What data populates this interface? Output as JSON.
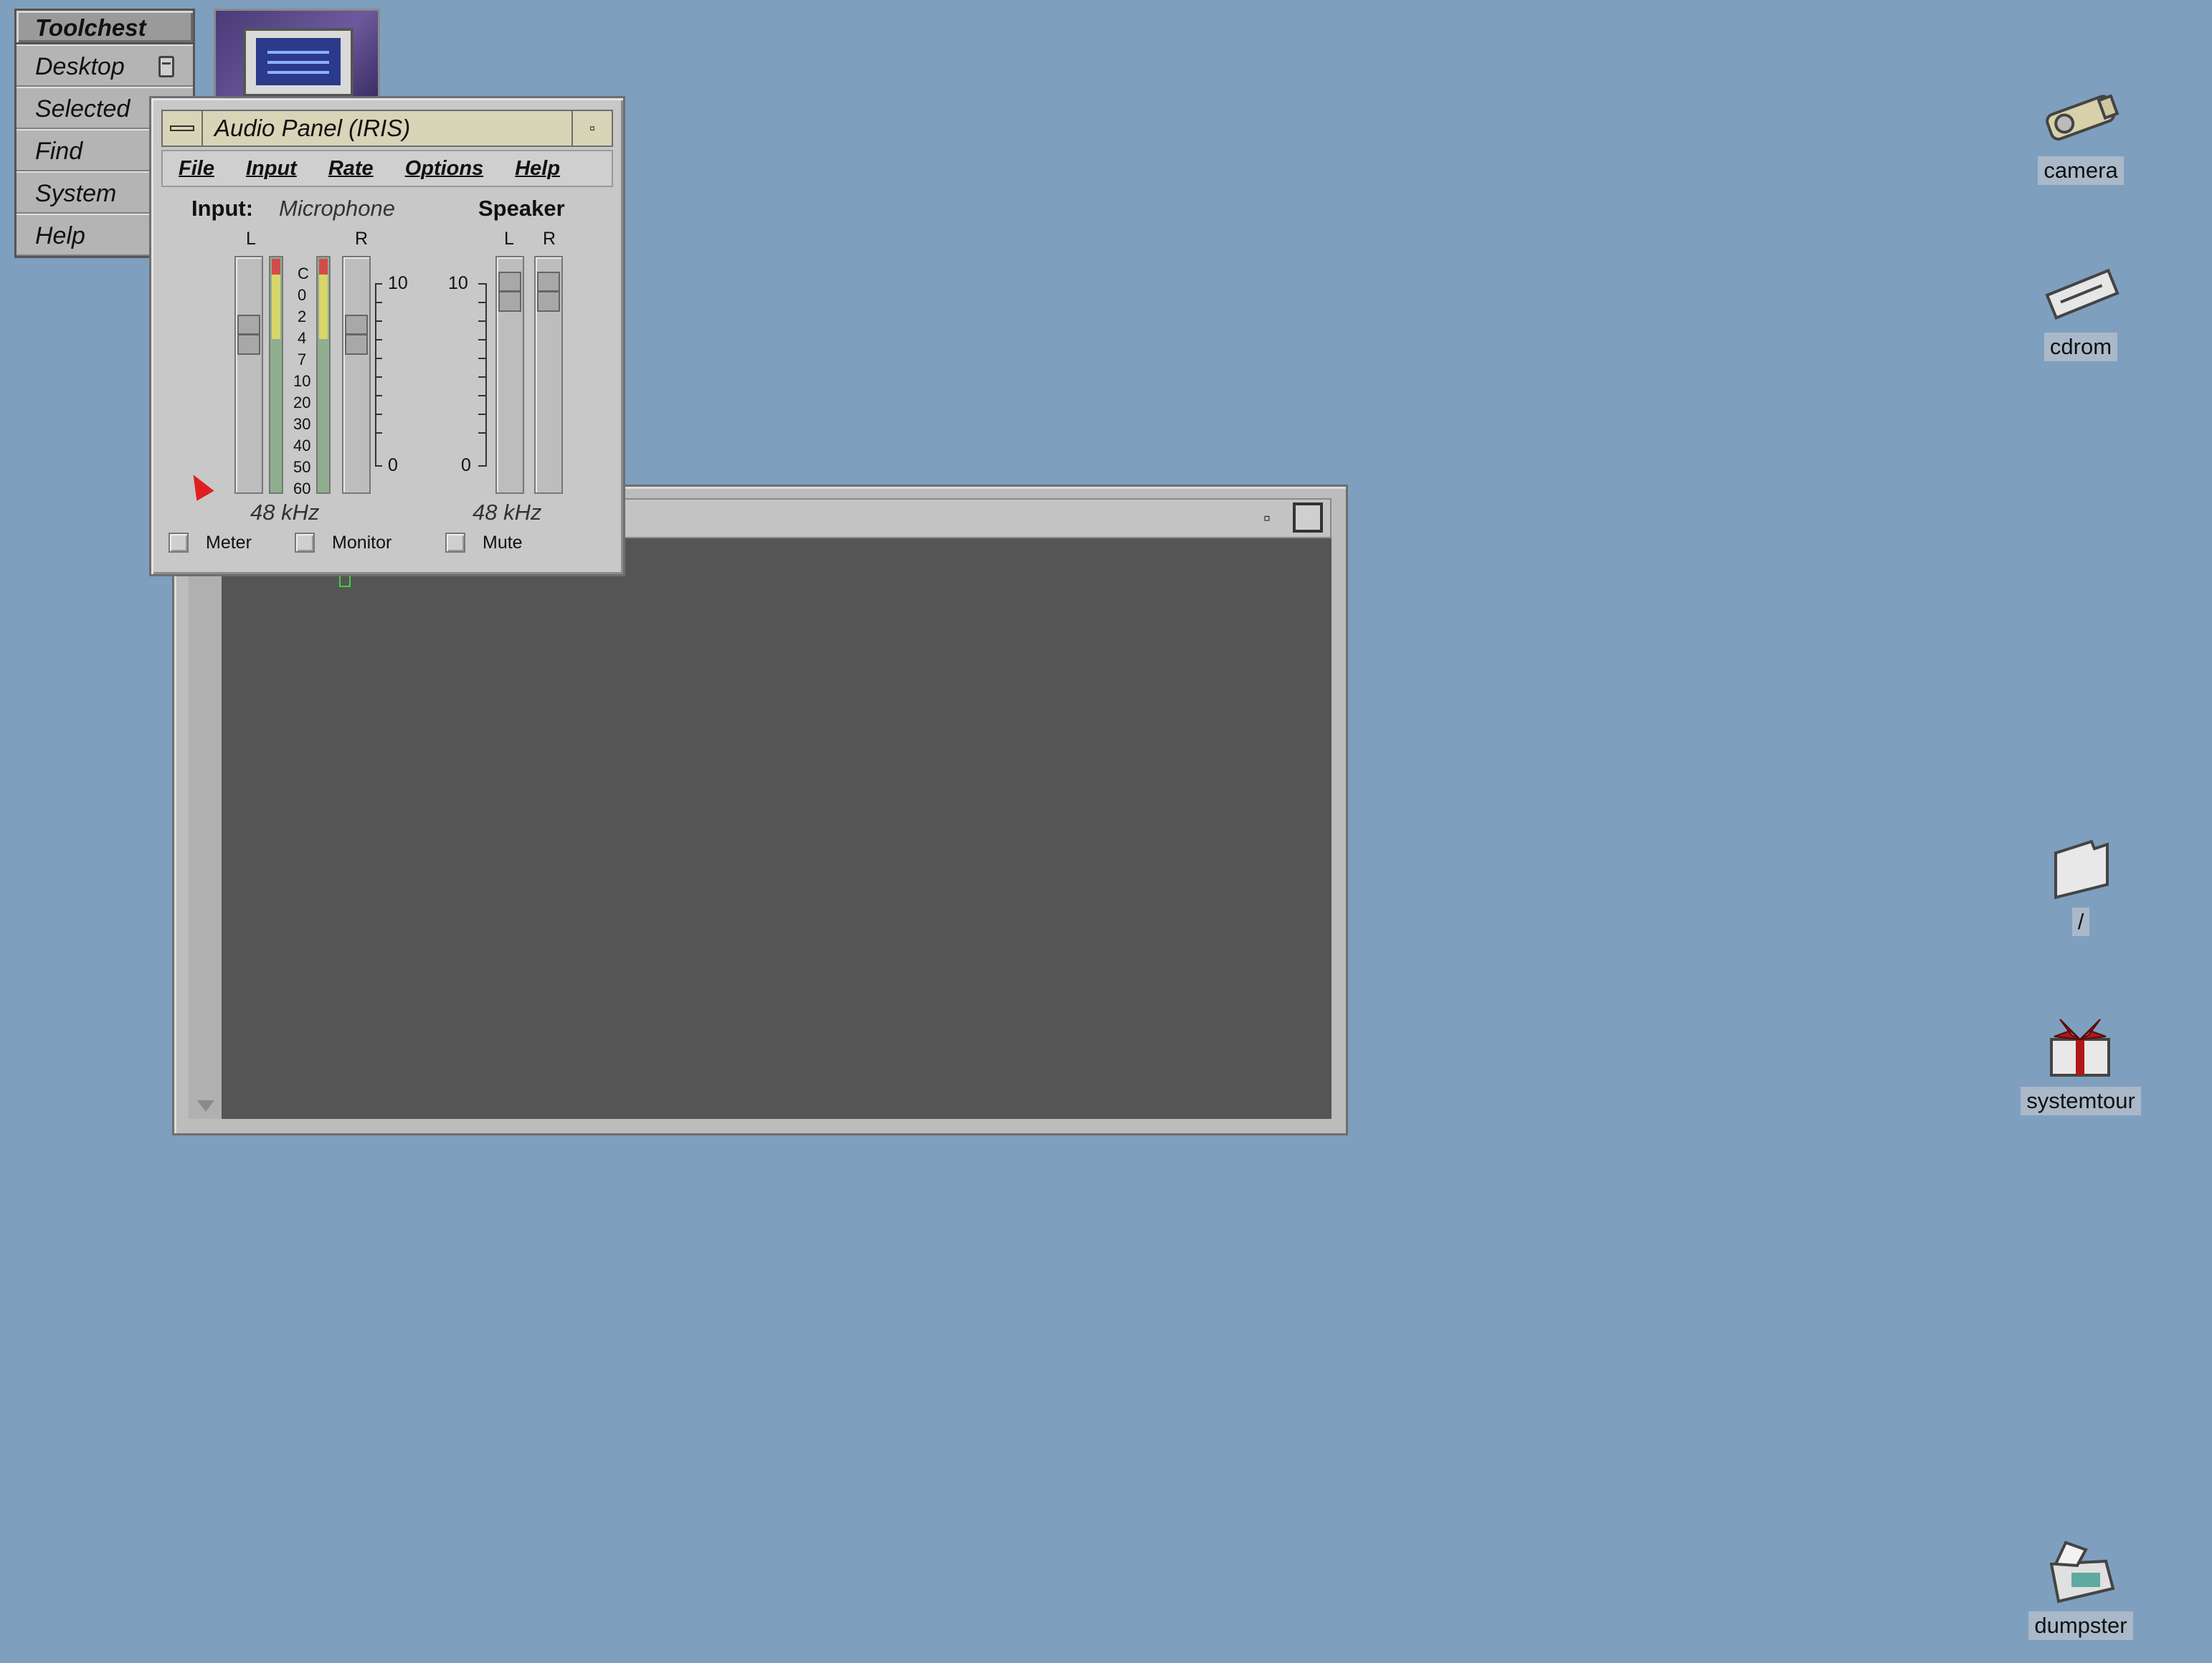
{
  "toolchest": {
    "title": "Toolchest",
    "items": [
      {
        "label": "Desktop"
      },
      {
        "label": "Selected"
      },
      {
        "label": "Find"
      },
      {
        "label": "System"
      },
      {
        "label": "Help"
      }
    ]
  },
  "desktop_icons": {
    "camera": "camera",
    "cdrom": "cdrom",
    "root": "/",
    "systemtour": "systemtour",
    "dumpster": "dumpster"
  },
  "audio_panel": {
    "title": "Audio Panel (IRIS)",
    "menu": [
      "File",
      "Input",
      "Rate",
      "Options",
      "Help"
    ],
    "input_label": "Input:",
    "input_source": "Microphone",
    "speaker_label": "Speaker",
    "left": "L",
    "right": "R",
    "meter_scale": [
      "C",
      "0",
      "2",
      "4",
      "7",
      "10",
      "20",
      "30",
      "40",
      "50",
      "60"
    ],
    "input_scale_top": "10",
    "input_scale_bottom": "0",
    "speaker_scale_top": "10",
    "speaker_scale_bottom": "0",
    "input_rate": "48 kHz",
    "output_rate": "48 kHz",
    "checkboxes": {
      "meter": "Meter",
      "monitor": "Monitor",
      "mute": "Mute"
    }
  },
  "icons": {
    "minimize": "minimize-icon",
    "maximize": "maximize-icon",
    "window_menu": "window-menu-icon",
    "pointer": "pointer-icon"
  },
  "colors": {
    "desktop": "#7f9fbf",
    "terminal_bg": "#555555",
    "meter_peak": "#d34b4b",
    "meter_mid": "#d8d66a",
    "meter_low": "#8fae8f"
  }
}
